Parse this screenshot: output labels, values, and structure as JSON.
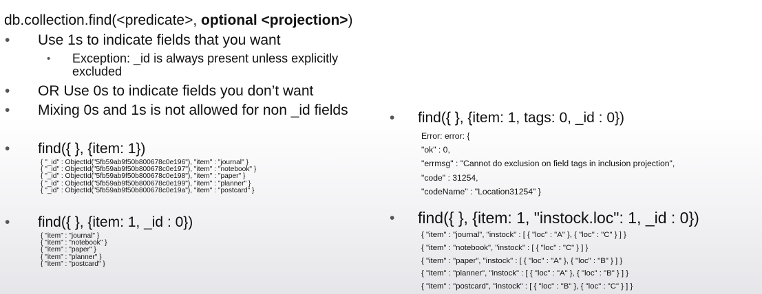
{
  "title": {
    "prefix": "db.collection.find(<predicate>, ",
    "bold": "optional <projection>",
    "suffix": ")"
  },
  "bullet_char": "•",
  "sub_bullet_char": "•",
  "rules": [
    "Use 1s to indicate fields that you want",
    "OR Use 0s to indicate fields you don’t want",
    "Mixing 0s and 1s is not allowed for non _id fields"
  ],
  "exception": {
    "line1": "Exception: _id is always present unless explicitly",
    "line2": "excluded"
  },
  "example1": {
    "call": "find({ }, {item: 1})",
    "results": [
      "{ \"_id\" : ObjectId(\"5fb59ab9f50b800678c0e196\"), \"item\" : \"journal\" }",
      "{ \"_id\" : ObjectId(\"5fb59ab9f50b800678c0e197\"), \"item\" : \"notebook\" }",
      "{ \"_id\" : ObjectId(\"5fb59ab9f50b800678c0e198\"), \"item\" : \"paper\" }",
      "{ \"_id\" : ObjectId(\"5fb59ab9f50b800678c0e199\"), \"item\" : \"planner\" }",
      "{ \"_id\" : ObjectId(\"5fb59ab9f50b800678c0e19a\"), \"item\" : \"postcard\" }"
    ]
  },
  "example2": {
    "call": "find({ }, {item: 1, _id : 0})",
    "results": [
      "{ \"item\" : \"journal\" }",
      "{ \"item\" : \"notebook\" }",
      "{ \"item\" : \"paper\" }",
      "{ \"item\" : \"planner\" }",
      "{ \"item\" : \"postcard\" }"
    ]
  },
  "example3": {
    "call": "find({ }, {item: 1, tags: 0, _id : 0})",
    "results": [
      "Error: error: {",
      "\"ok\" : 0,",
      "\"errmsg\" : \"Cannot do exclusion on field tags in inclusion projection\",",
      "\"code\" : 31254,",
      "\"codeName\" : \"Location31254\" }"
    ]
  },
  "example4": {
    "call": "find({ }, {item: 1, \"instock.loc\": 1, _id : 0})",
    "results": [
      "{ \"item\" : \"journal\", \"instock\" : [ { \"loc\" : \"A\" }, { \"loc\" : \"C\" } ] }",
      "{ \"item\" : \"notebook\", \"instock\" : [ { \"loc\" : \"C\" } ] }",
      "{ \"item\" : \"paper\", \"instock\" : [ { \"loc\" : \"A\" }, { \"loc\" : \"B\" } ] }",
      "{ \"item\" : \"planner\", \"instock\" : [ { \"loc\" : \"A\" }, { \"loc\" : \"B\" } ] }",
      "{ \"item\" : \"postcard\", \"instock\" : [ { \"loc\" : \"B\" }, { \"loc\" : \"C\" } ] }"
    ]
  }
}
